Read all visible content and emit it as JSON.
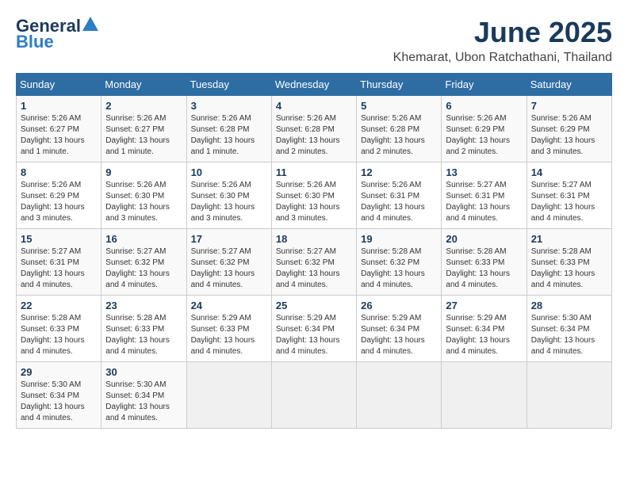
{
  "logo": {
    "general": "General",
    "blue": "Blue"
  },
  "title": "June 2025",
  "subtitle": "Khemarat, Ubon Ratchathani, Thailand",
  "weekdays": [
    "Sunday",
    "Monday",
    "Tuesday",
    "Wednesday",
    "Thursday",
    "Friday",
    "Saturday"
  ],
  "weeks": [
    [
      {
        "day": "1",
        "sunrise": "5:26 AM",
        "sunset": "6:27 PM",
        "daylight": "13 hours and 1 minute."
      },
      {
        "day": "2",
        "sunrise": "5:26 AM",
        "sunset": "6:27 PM",
        "daylight": "13 hours and 1 minute."
      },
      {
        "day": "3",
        "sunrise": "5:26 AM",
        "sunset": "6:28 PM",
        "daylight": "13 hours and 1 minute."
      },
      {
        "day": "4",
        "sunrise": "5:26 AM",
        "sunset": "6:28 PM",
        "daylight": "13 hours and 2 minutes."
      },
      {
        "day": "5",
        "sunrise": "5:26 AM",
        "sunset": "6:28 PM",
        "daylight": "13 hours and 2 minutes."
      },
      {
        "day": "6",
        "sunrise": "5:26 AM",
        "sunset": "6:29 PM",
        "daylight": "13 hours and 2 minutes."
      },
      {
        "day": "7",
        "sunrise": "5:26 AM",
        "sunset": "6:29 PM",
        "daylight": "13 hours and 3 minutes."
      }
    ],
    [
      {
        "day": "8",
        "sunrise": "5:26 AM",
        "sunset": "6:29 PM",
        "daylight": "13 hours and 3 minutes."
      },
      {
        "day": "9",
        "sunrise": "5:26 AM",
        "sunset": "6:30 PM",
        "daylight": "13 hours and 3 minutes."
      },
      {
        "day": "10",
        "sunrise": "5:26 AM",
        "sunset": "6:30 PM",
        "daylight": "13 hours and 3 minutes."
      },
      {
        "day": "11",
        "sunrise": "5:26 AM",
        "sunset": "6:30 PM",
        "daylight": "13 hours and 3 minutes."
      },
      {
        "day": "12",
        "sunrise": "5:26 AM",
        "sunset": "6:31 PM",
        "daylight": "13 hours and 4 minutes."
      },
      {
        "day": "13",
        "sunrise": "5:27 AM",
        "sunset": "6:31 PM",
        "daylight": "13 hours and 4 minutes."
      },
      {
        "day": "14",
        "sunrise": "5:27 AM",
        "sunset": "6:31 PM",
        "daylight": "13 hours and 4 minutes."
      }
    ],
    [
      {
        "day": "15",
        "sunrise": "5:27 AM",
        "sunset": "6:31 PM",
        "daylight": "13 hours and 4 minutes."
      },
      {
        "day": "16",
        "sunrise": "5:27 AM",
        "sunset": "6:32 PM",
        "daylight": "13 hours and 4 minutes."
      },
      {
        "day": "17",
        "sunrise": "5:27 AM",
        "sunset": "6:32 PM",
        "daylight": "13 hours and 4 minutes."
      },
      {
        "day": "18",
        "sunrise": "5:27 AM",
        "sunset": "6:32 PM",
        "daylight": "13 hours and 4 minutes."
      },
      {
        "day": "19",
        "sunrise": "5:28 AM",
        "sunset": "6:32 PM",
        "daylight": "13 hours and 4 minutes."
      },
      {
        "day": "20",
        "sunrise": "5:28 AM",
        "sunset": "6:33 PM",
        "daylight": "13 hours and 4 minutes."
      },
      {
        "day": "21",
        "sunrise": "5:28 AM",
        "sunset": "6:33 PM",
        "daylight": "13 hours and 4 minutes."
      }
    ],
    [
      {
        "day": "22",
        "sunrise": "5:28 AM",
        "sunset": "6:33 PM",
        "daylight": "13 hours and 4 minutes."
      },
      {
        "day": "23",
        "sunrise": "5:28 AM",
        "sunset": "6:33 PM",
        "daylight": "13 hours and 4 minutes."
      },
      {
        "day": "24",
        "sunrise": "5:29 AM",
        "sunset": "6:33 PM",
        "daylight": "13 hours and 4 minutes."
      },
      {
        "day": "25",
        "sunrise": "5:29 AM",
        "sunset": "6:34 PM",
        "daylight": "13 hours and 4 minutes."
      },
      {
        "day": "26",
        "sunrise": "5:29 AM",
        "sunset": "6:34 PM",
        "daylight": "13 hours and 4 minutes."
      },
      {
        "day": "27",
        "sunrise": "5:29 AM",
        "sunset": "6:34 PM",
        "daylight": "13 hours and 4 minutes."
      },
      {
        "day": "28",
        "sunrise": "5:30 AM",
        "sunset": "6:34 PM",
        "daylight": "13 hours and 4 minutes."
      }
    ],
    [
      {
        "day": "29",
        "sunrise": "5:30 AM",
        "sunset": "6:34 PM",
        "daylight": "13 hours and 4 minutes."
      },
      {
        "day": "30",
        "sunrise": "5:30 AM",
        "sunset": "6:34 PM",
        "daylight": "13 hours and 4 minutes."
      },
      null,
      null,
      null,
      null,
      null
    ]
  ]
}
